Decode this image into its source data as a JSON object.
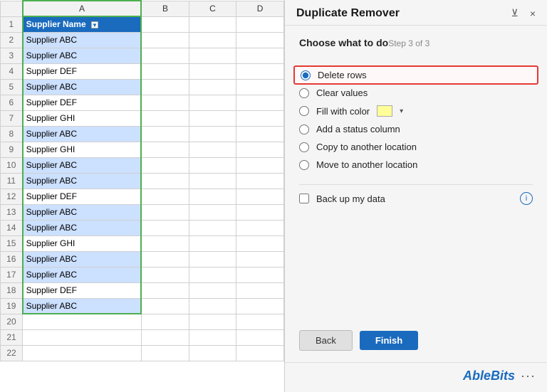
{
  "spreadsheet": {
    "col_headers": [
      "",
      "A",
      "B",
      "C",
      "D"
    ],
    "header_row": {
      "label": "Supplier Name",
      "has_filter": true
    },
    "rows": [
      {
        "num": 2,
        "val": "Supplier ABC",
        "highlighted": true
      },
      {
        "num": 3,
        "val": "Supplier ABC",
        "highlighted": true
      },
      {
        "num": 4,
        "val": "Supplier DEF",
        "highlighted": false
      },
      {
        "num": 5,
        "val": "Supplier ABC",
        "highlighted": true
      },
      {
        "num": 6,
        "val": "Supplier DEF",
        "highlighted": false
      },
      {
        "num": 7,
        "val": "Supplier GHI",
        "highlighted": false
      },
      {
        "num": 8,
        "val": "Supplier ABC",
        "highlighted": true
      },
      {
        "num": 9,
        "val": "Supplier GHI",
        "highlighted": false
      },
      {
        "num": 10,
        "val": "Supplier ABC",
        "highlighted": true
      },
      {
        "num": 11,
        "val": "Supplier ABC",
        "highlighted": true
      },
      {
        "num": 12,
        "val": "Supplier DEF",
        "highlighted": false
      },
      {
        "num": 13,
        "val": "Supplier ABC",
        "highlighted": true
      },
      {
        "num": 14,
        "val": "Supplier ABC",
        "highlighted": true
      },
      {
        "num": 15,
        "val": "Supplier GHI",
        "highlighted": false
      },
      {
        "num": 16,
        "val": "Supplier ABC",
        "highlighted": true
      },
      {
        "num": 17,
        "val": "Supplier ABC",
        "highlighted": true
      },
      {
        "num": 18,
        "val": "Supplier DEF",
        "highlighted": false
      },
      {
        "num": 19,
        "val": "Supplier ABC",
        "highlighted": true
      }
    ],
    "empty_rows": [
      20,
      21,
      22
    ]
  },
  "panel": {
    "title": "Duplicate Remover",
    "step_label": "Step 3 of 3",
    "section_title": "Choose what to do",
    "options": [
      {
        "id": "delete-rows",
        "label": "Delete rows",
        "selected": true
      },
      {
        "id": "clear-values",
        "label": "Clear values",
        "selected": false
      },
      {
        "id": "fill-with-color",
        "label": "Fill with color",
        "selected": false,
        "has_color": true,
        "color": "#ffff99"
      },
      {
        "id": "add-status",
        "label": "Add a status column",
        "selected": false
      },
      {
        "id": "copy-location",
        "label": "Copy to another location",
        "selected": false
      },
      {
        "id": "move-location",
        "label": "Move to another location",
        "selected": false
      }
    ],
    "backup_label": "Back up my data",
    "back_btn": "Back",
    "finish_btn": "Finish",
    "brand": "AbleBits",
    "brand_color_part": "Able",
    "close_icon": "×",
    "more_dots": "···"
  }
}
